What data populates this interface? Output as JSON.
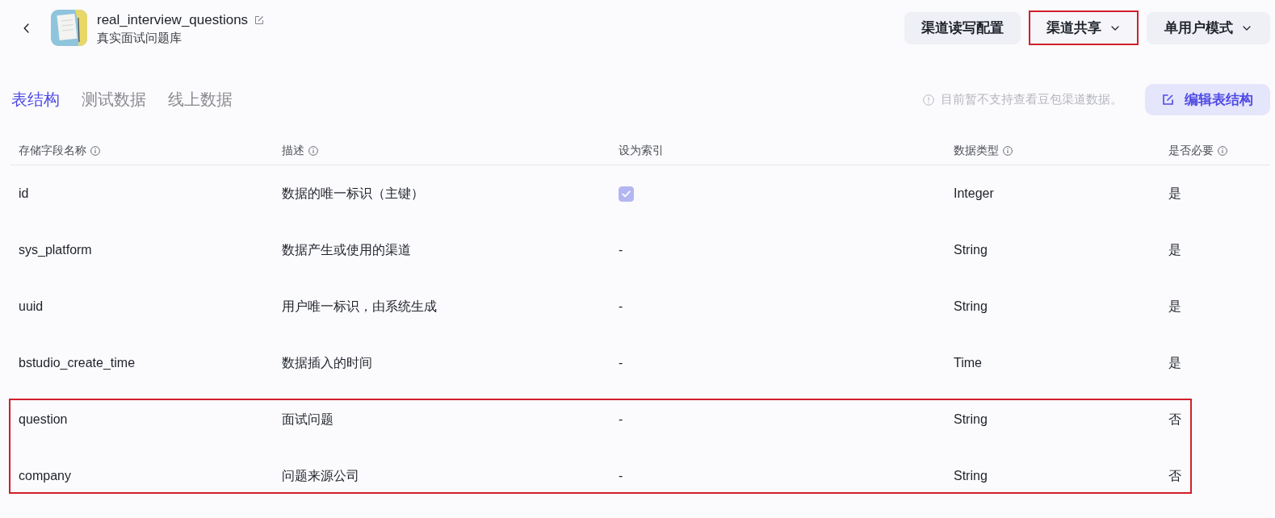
{
  "header": {
    "title": "real_interview_questions",
    "subtitle": "真实面试问题库"
  },
  "actions": [
    {
      "label": "渠道读写配置",
      "dropdown": false,
      "highlighted": false
    },
    {
      "label": "渠道共享",
      "dropdown": true,
      "highlighted": true
    },
    {
      "label": "单用户模式",
      "dropdown": true,
      "highlighted": false
    }
  ],
  "tabs": [
    {
      "label": "表结构",
      "selected": true
    },
    {
      "label": "测试数据",
      "selected": false
    },
    {
      "label": "线上数据",
      "selected": false
    }
  ],
  "notice": "目前暂不支持查看豆包渠道数据。",
  "edit_button": "编辑表结构",
  "table": {
    "columns": [
      {
        "label": "存储字段名称",
        "info": true
      },
      {
        "label": "描述",
        "info": true
      },
      {
        "label": "设为索引",
        "info": false
      },
      {
        "label": "数据类型",
        "info": true
      },
      {
        "label": "是否必要",
        "info": true
      }
    ],
    "rows": [
      {
        "name": "id",
        "description": "数据的唯一标识（主键）",
        "index": {
          "kind": "checkbox",
          "checked": true,
          "disabled": true
        },
        "type": "Integer",
        "required": "是",
        "highlighted": false
      },
      {
        "name": "sys_platform",
        "description": "数据产生或使用的渠道",
        "index": {
          "kind": "text",
          "text": "-"
        },
        "type": "String",
        "required": "是",
        "highlighted": false
      },
      {
        "name": "uuid",
        "description": "用户唯一标识，由系统生成",
        "index": {
          "kind": "text",
          "text": "-"
        },
        "type": "String",
        "required": "是",
        "highlighted": false
      },
      {
        "name": "bstudio_create_time",
        "description": "数据插入的时间",
        "index": {
          "kind": "text",
          "text": "-"
        },
        "type": "Time",
        "required": "是",
        "highlighted": false
      },
      {
        "name": "question",
        "description": "面试问题",
        "index": {
          "kind": "text",
          "text": "-"
        },
        "type": "String",
        "required": "否",
        "highlighted": true
      },
      {
        "name": "company",
        "description": "问题来源公司",
        "index": {
          "kind": "text",
          "text": "-"
        },
        "type": "String",
        "required": "否",
        "highlighted": true
      }
    ]
  }
}
